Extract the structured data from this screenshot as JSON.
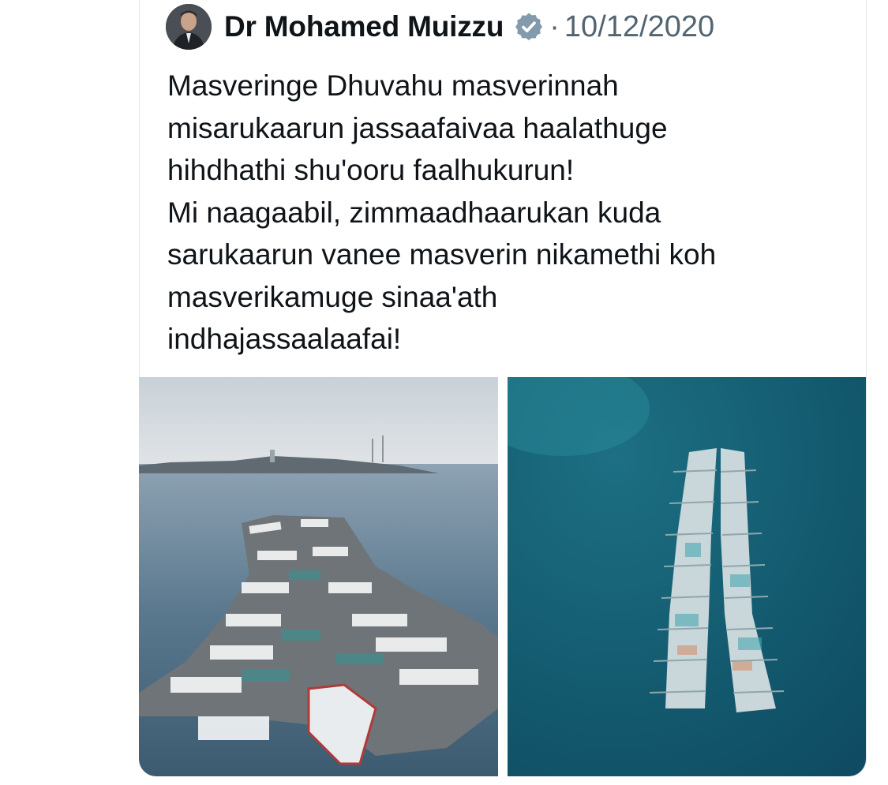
{
  "tweet": {
    "author_name": "Dr Mohamed Muizzu",
    "verified_icon": "verified-badge-icon",
    "separator": "·",
    "date": "10/12/2020",
    "text": "Masveringe Dhuvahu masverinnah\nmisarukaarun jassaafaivaa haalathuge\nhihdhathi shu'ooru faalhukurun!\nMi naagaabil, zimmaadhaarukan kuda\nsarukaarun vanee masverin nikamethi koh\nmasverikamuge sinaa'ath\nindhajassaalaafai!"
  },
  "colors": {
    "text": "#0f1419",
    "secondary_text": "#536471",
    "verified_badge": "#829aab"
  }
}
